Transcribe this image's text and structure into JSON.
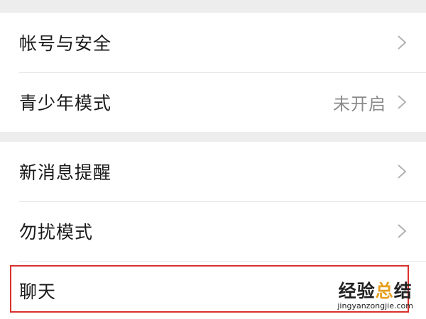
{
  "settings": {
    "group1": [
      {
        "label": "帐号与安全",
        "value": ""
      },
      {
        "label": "青少年模式",
        "value": "未开启"
      }
    ],
    "group2": [
      {
        "label": "新消息提醒",
        "value": ""
      },
      {
        "label": "勿扰模式",
        "value": ""
      },
      {
        "label": "聊天",
        "value": ""
      }
    ]
  },
  "icons": {
    "chevron": "chevron-right-icon"
  },
  "colors": {
    "highlight": "#d9312c",
    "divider_background": "#ededed",
    "watermark_accent": "#e6a020"
  },
  "watermark": {
    "part1": "经验",
    "part2": "总",
    "part3": "结",
    "url": "jingyanzongjie.com"
  }
}
